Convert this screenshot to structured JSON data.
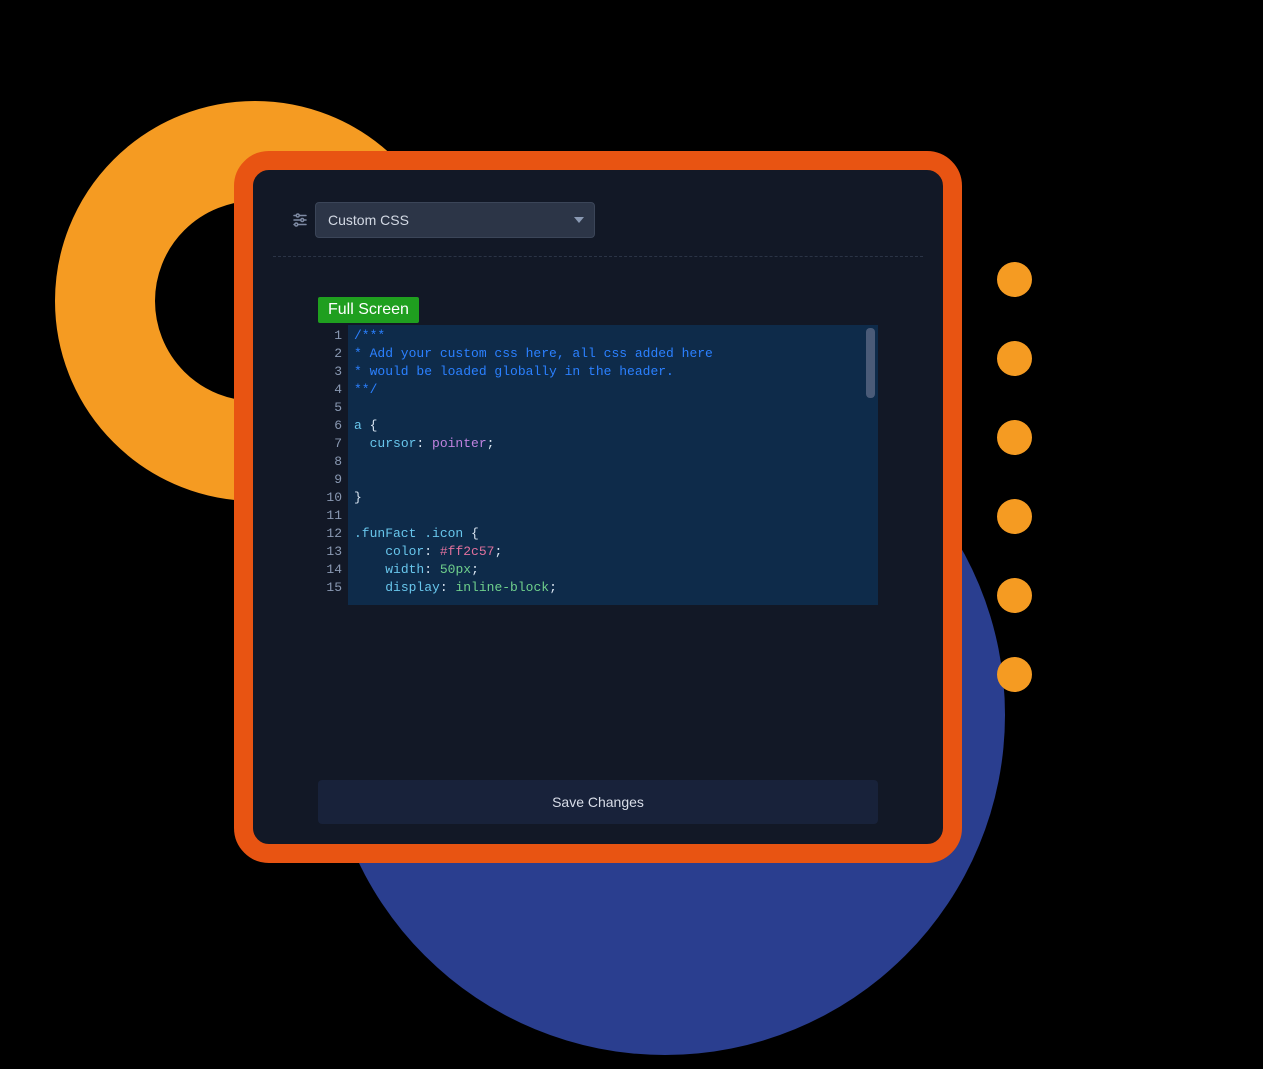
{
  "select": {
    "label": "Custom CSS"
  },
  "buttons": {
    "full_screen": "Full Screen",
    "save": "Save Changes"
  },
  "editor": {
    "line_numbers": [
      "1",
      "2",
      "3",
      "4",
      "5",
      "6",
      "7",
      "8",
      "9",
      "10",
      "11",
      "12",
      "13",
      "14",
      "15"
    ],
    "lines": [
      [
        {
          "cls": "tok-comment",
          "t": "/***"
        }
      ],
      [
        {
          "cls": "tok-comment",
          "t": "* Add your custom css here, all css added here"
        }
      ],
      [
        {
          "cls": "tok-comment",
          "t": "* would be loaded globally in the header."
        }
      ],
      [
        {
          "cls": "tok-comment",
          "t": "**/"
        }
      ],
      [],
      [
        {
          "cls": "tok-selector",
          "t": "a"
        },
        {
          "cls": "tok-punc",
          "t": " "
        },
        {
          "cls": "tok-brace",
          "t": "{"
        }
      ],
      [
        {
          "cls": "",
          "t": "  "
        },
        {
          "cls": "tok-prop",
          "t": "cursor"
        },
        {
          "cls": "tok-punc",
          "t": ": "
        },
        {
          "cls": "tok-value-pointer",
          "t": "pointer"
        },
        {
          "cls": "tok-punc",
          "t": ";"
        }
      ],
      [],
      [],
      [
        {
          "cls": "tok-brace",
          "t": "}"
        }
      ],
      [],
      [
        {
          "cls": "tok-selector",
          "t": ".funFact .icon"
        },
        {
          "cls": "tok-punc",
          "t": " "
        },
        {
          "cls": "tok-brace",
          "t": "{"
        }
      ],
      [
        {
          "cls": "",
          "t": "    "
        },
        {
          "cls": "tok-prop",
          "t": "color"
        },
        {
          "cls": "tok-punc",
          "t": ": "
        },
        {
          "cls": "tok-value-color",
          "t": "#ff2c57"
        },
        {
          "cls": "tok-punc",
          "t": ";"
        }
      ],
      [
        {
          "cls": "",
          "t": "    "
        },
        {
          "cls": "tok-prop",
          "t": "width"
        },
        {
          "cls": "tok-punc",
          "t": ": "
        },
        {
          "cls": "tok-value-num",
          "t": "50px"
        },
        {
          "cls": "tok-punc",
          "t": ";"
        }
      ],
      [
        {
          "cls": "",
          "t": "    "
        },
        {
          "cls": "tok-prop",
          "t": "display"
        },
        {
          "cls": "tok-punc",
          "t": ": "
        },
        {
          "cls": "tok-value-kw",
          "t": "inline-block"
        },
        {
          "cls": "tok-punc",
          "t": ";"
        }
      ]
    ]
  }
}
